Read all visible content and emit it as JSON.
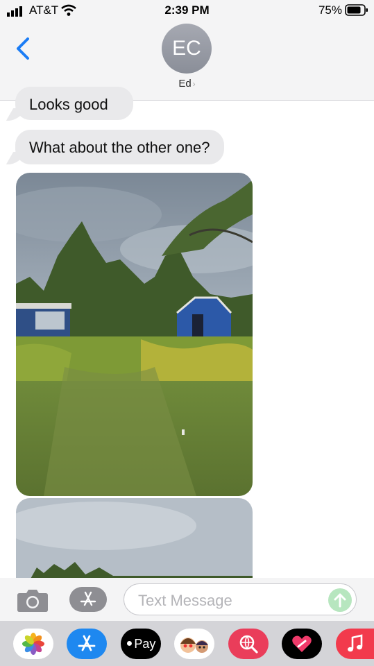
{
  "status_bar": {
    "carrier": "AT&T",
    "time": "2:39 PM",
    "battery": "75%"
  },
  "header": {
    "avatar_initials": "EC",
    "contact_name": "Ed"
  },
  "messages": [
    {
      "text": "Looks good",
      "direction": "incoming"
    },
    {
      "text": "What about the other one?",
      "direction": "incoming"
    }
  ],
  "input": {
    "placeholder": "Text Message"
  },
  "app_drawer": {
    "apple_pay_label": "Pay",
    "apps": [
      "photos-icon",
      "appstore-icon",
      "apple-pay-icon",
      "memoji-icon",
      "web-search-icon",
      "digital-touch-icon",
      "music-icon"
    ]
  },
  "colors": {
    "accent": "#1a7cf5",
    "bubble_incoming": "#e9e9eb",
    "send_disabled": "#b7e6bf"
  }
}
